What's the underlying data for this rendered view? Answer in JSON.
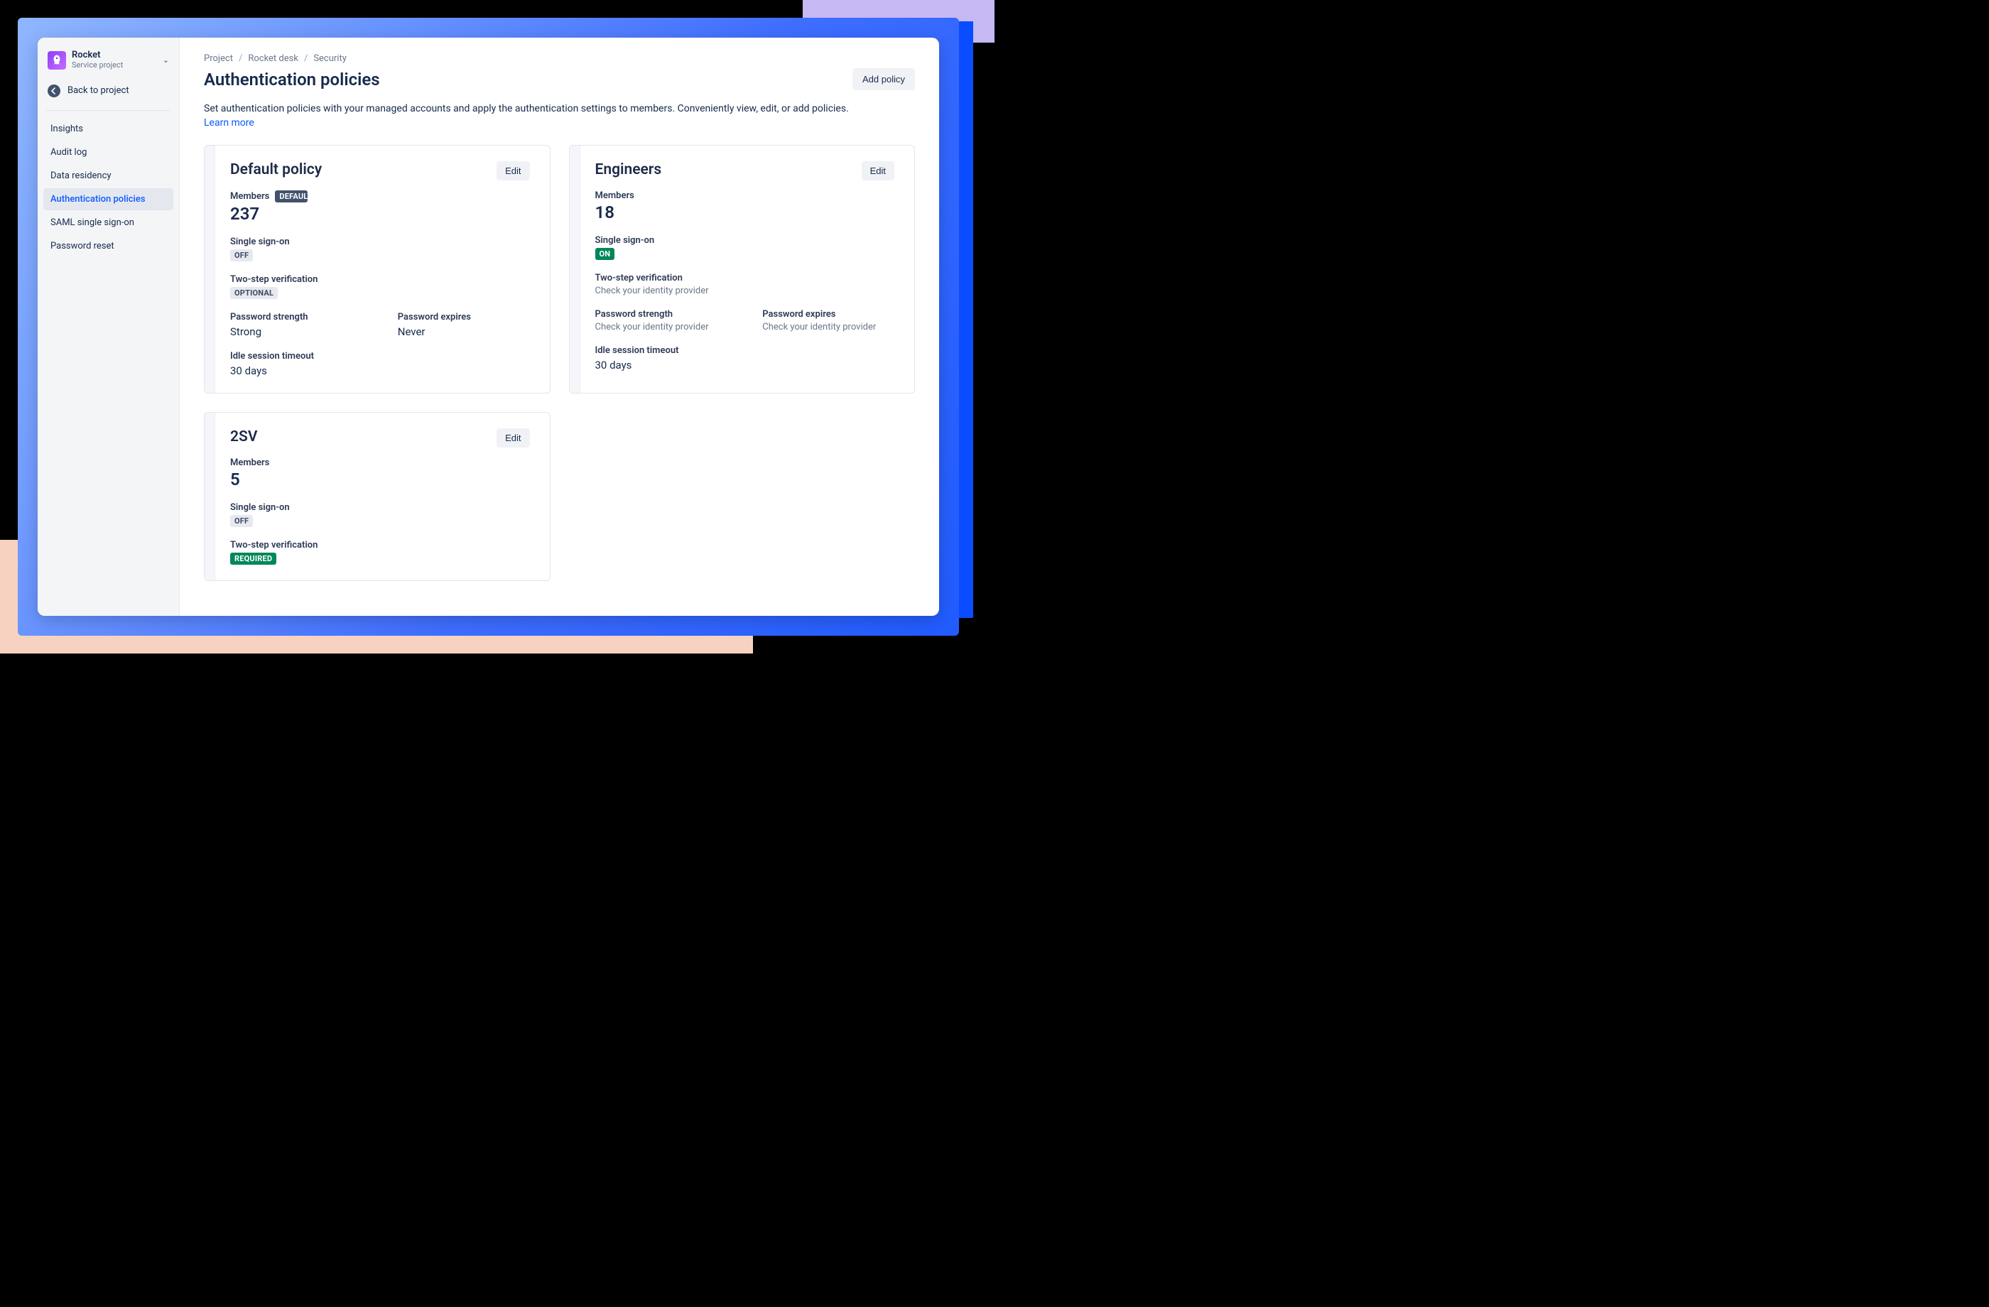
{
  "sidebar": {
    "project_name": "Rocket",
    "project_sub": "Service project",
    "back_label": "Back to project",
    "nav": [
      {
        "label": "Insights"
      },
      {
        "label": "Audit log"
      },
      {
        "label": "Data residency"
      },
      {
        "label": "Authentication policies",
        "active": true
      },
      {
        "label": "SAML single sign-on"
      },
      {
        "label": "Password reset"
      }
    ]
  },
  "breadcrumbs": [
    "Project",
    "Rocket desk",
    "Security"
  ],
  "page_title": "Authentication policies",
  "add_button": "Add policy",
  "description": "Set authentication policies with your managed accounts and apply the authentication settings to members. Conveniently view, edit, or add policies.",
  "learn_more": "Learn more",
  "labels": {
    "members": "Members",
    "sso": "Single sign-on",
    "twostep": "Two-step verification",
    "pw_strength": "Password strength",
    "pw_expires": "Password expires",
    "idle": "Idle session timeout",
    "edit": "Edit",
    "check_idp": "Check your identity provider"
  },
  "policies": [
    {
      "name": "Default policy",
      "default_badge": "DEFAULT",
      "members": "237",
      "sso": {
        "badge": "OFF",
        "style": "gray"
      },
      "twostep": {
        "badge": "OPTIONAL",
        "style": "gray"
      },
      "pw_strength": "Strong",
      "pw_expires": "Never",
      "idle": "30 days"
    },
    {
      "name": "Engineers",
      "members": "18",
      "sso": {
        "badge": "ON",
        "style": "green"
      },
      "twostep": {
        "note": true
      },
      "pw_strength_note": true,
      "pw_expires_note": true,
      "idle": "30 days"
    },
    {
      "name": "2SV",
      "members": "5",
      "sso": {
        "badge": "OFF",
        "style": "gray"
      },
      "twostep": {
        "badge": "REQUIRED",
        "style": "green"
      }
    }
  ]
}
